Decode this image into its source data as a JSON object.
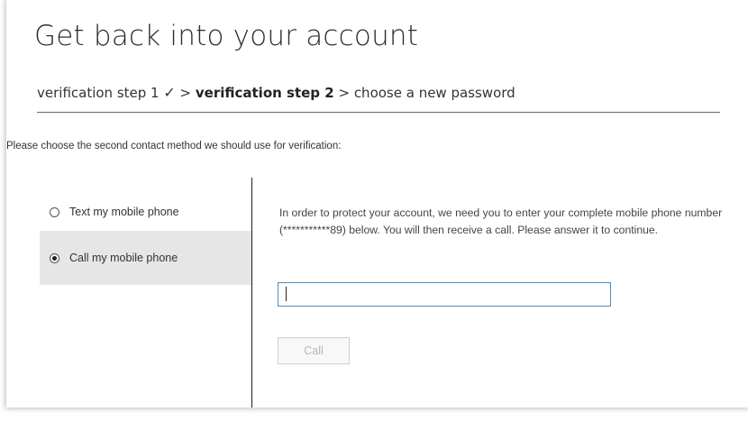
{
  "page": {
    "title": "Get back into your account"
  },
  "breadcrumb": {
    "step1": "verification step 1",
    "step1_check": "✓",
    "separator1": " > ",
    "step2": "verification step 2",
    "separator2": " > ",
    "step3": "choose a new password"
  },
  "instruction": "Please choose the second contact method we should use for verification:",
  "options": [
    {
      "label": "Text my mobile phone",
      "selected": false
    },
    {
      "label": "Call my mobile phone",
      "selected": true
    }
  ],
  "main": {
    "description": "In order to protect your account, we need you to enter your complete mobile phone number (***********89) below. You will then receive a call. Please answer it to continue.",
    "phone_input_value": "",
    "call_button_label": "Call",
    "call_button_enabled": false
  },
  "colors": {
    "input_border": "#4d8fc1",
    "selected_option_bg": "#e6e6e6",
    "disabled_button_text": "#b5b5b5"
  }
}
